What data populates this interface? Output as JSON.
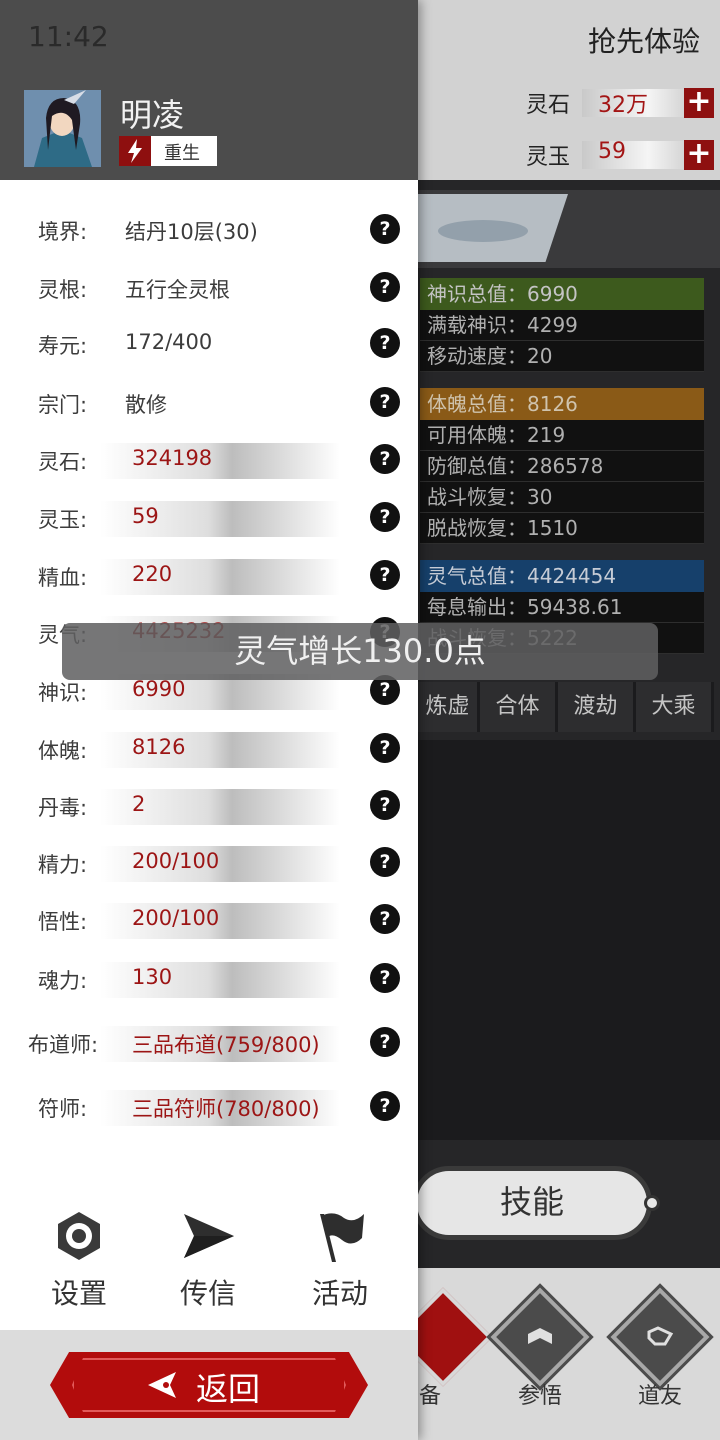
{
  "status_bar": {
    "time": "11:42"
  },
  "background": {
    "header_title": "抢先体验",
    "resources": [
      {
        "label": "灵石",
        "value": "32万"
      },
      {
        "label": "灵玉",
        "value": "59"
      }
    ],
    "stat_groups": [
      {
        "header": "神识总值：6990",
        "color": "#3d5a1d",
        "lines": [
          "满载神识：4299",
          "移动速度：20"
        ]
      },
      {
        "header": "体魄总值：8126",
        "color": "#8a5a17",
        "lines": [
          "可用体魄：219",
          "防御总值：286578",
          "战斗恢复：30",
          "脱战恢复：1510"
        ]
      },
      {
        "header": "灵气总值：4424454",
        "color": "#16406b",
        "lines": [
          "每息输出：59438.61",
          "战斗恢复：5222"
        ]
      }
    ],
    "realm_tabs": [
      "炼虚",
      "合体",
      "渡劫",
      "大乘"
    ],
    "skill_button": "技能",
    "bottom_nav": [
      "备",
      "参悟",
      "道友"
    ]
  },
  "drawer": {
    "player": {
      "name": "明凌",
      "tag": "重生"
    },
    "attributes": [
      {
        "label": "境界:",
        "value": "结丹10层(30)",
        "style": "plain"
      },
      {
        "label": "灵根:",
        "value": "五行全灵根",
        "style": "plain"
      },
      {
        "label": "寿元:",
        "value": "172/400",
        "style": "plain"
      },
      {
        "label": "宗门:",
        "value": "散修",
        "style": "plain"
      },
      {
        "label": "灵石:",
        "value": "324198",
        "style": "bar"
      },
      {
        "label": "灵玉:",
        "value": "59",
        "style": "bar"
      },
      {
        "label": "精血:",
        "value": "220",
        "style": "bar"
      },
      {
        "label": "灵气:",
        "value": "4425232",
        "style": "bar"
      },
      {
        "label": "神识:",
        "value": "6990",
        "style": "bar"
      },
      {
        "label": "体魄:",
        "value": "8126",
        "style": "bar"
      },
      {
        "label": "丹毒:",
        "value": "2",
        "style": "bar"
      },
      {
        "label": "精力:",
        "value": "200/100",
        "style": "bar"
      },
      {
        "label": "悟性:",
        "value": "200/100",
        "style": "bar"
      },
      {
        "label": "魂力:",
        "value": "130",
        "style": "bar"
      },
      {
        "label": "布道师:",
        "value": "三品布道(759/800)",
        "style": "bar"
      },
      {
        "label": "符师:",
        "value": "三品符师(780/800)",
        "style": "bar"
      }
    ],
    "help_glyph": "?",
    "actions": [
      {
        "label": "设置",
        "icon": "gear-icon"
      },
      {
        "label": "传信",
        "icon": "send-icon"
      },
      {
        "label": "活动",
        "icon": "flag-icon"
      }
    ],
    "back_button": "返回"
  },
  "toast": {
    "message": "灵气增长130.0点"
  },
  "colors": {
    "accent_red": "#9c1515",
    "drawer_header": "#4c4c4c"
  }
}
